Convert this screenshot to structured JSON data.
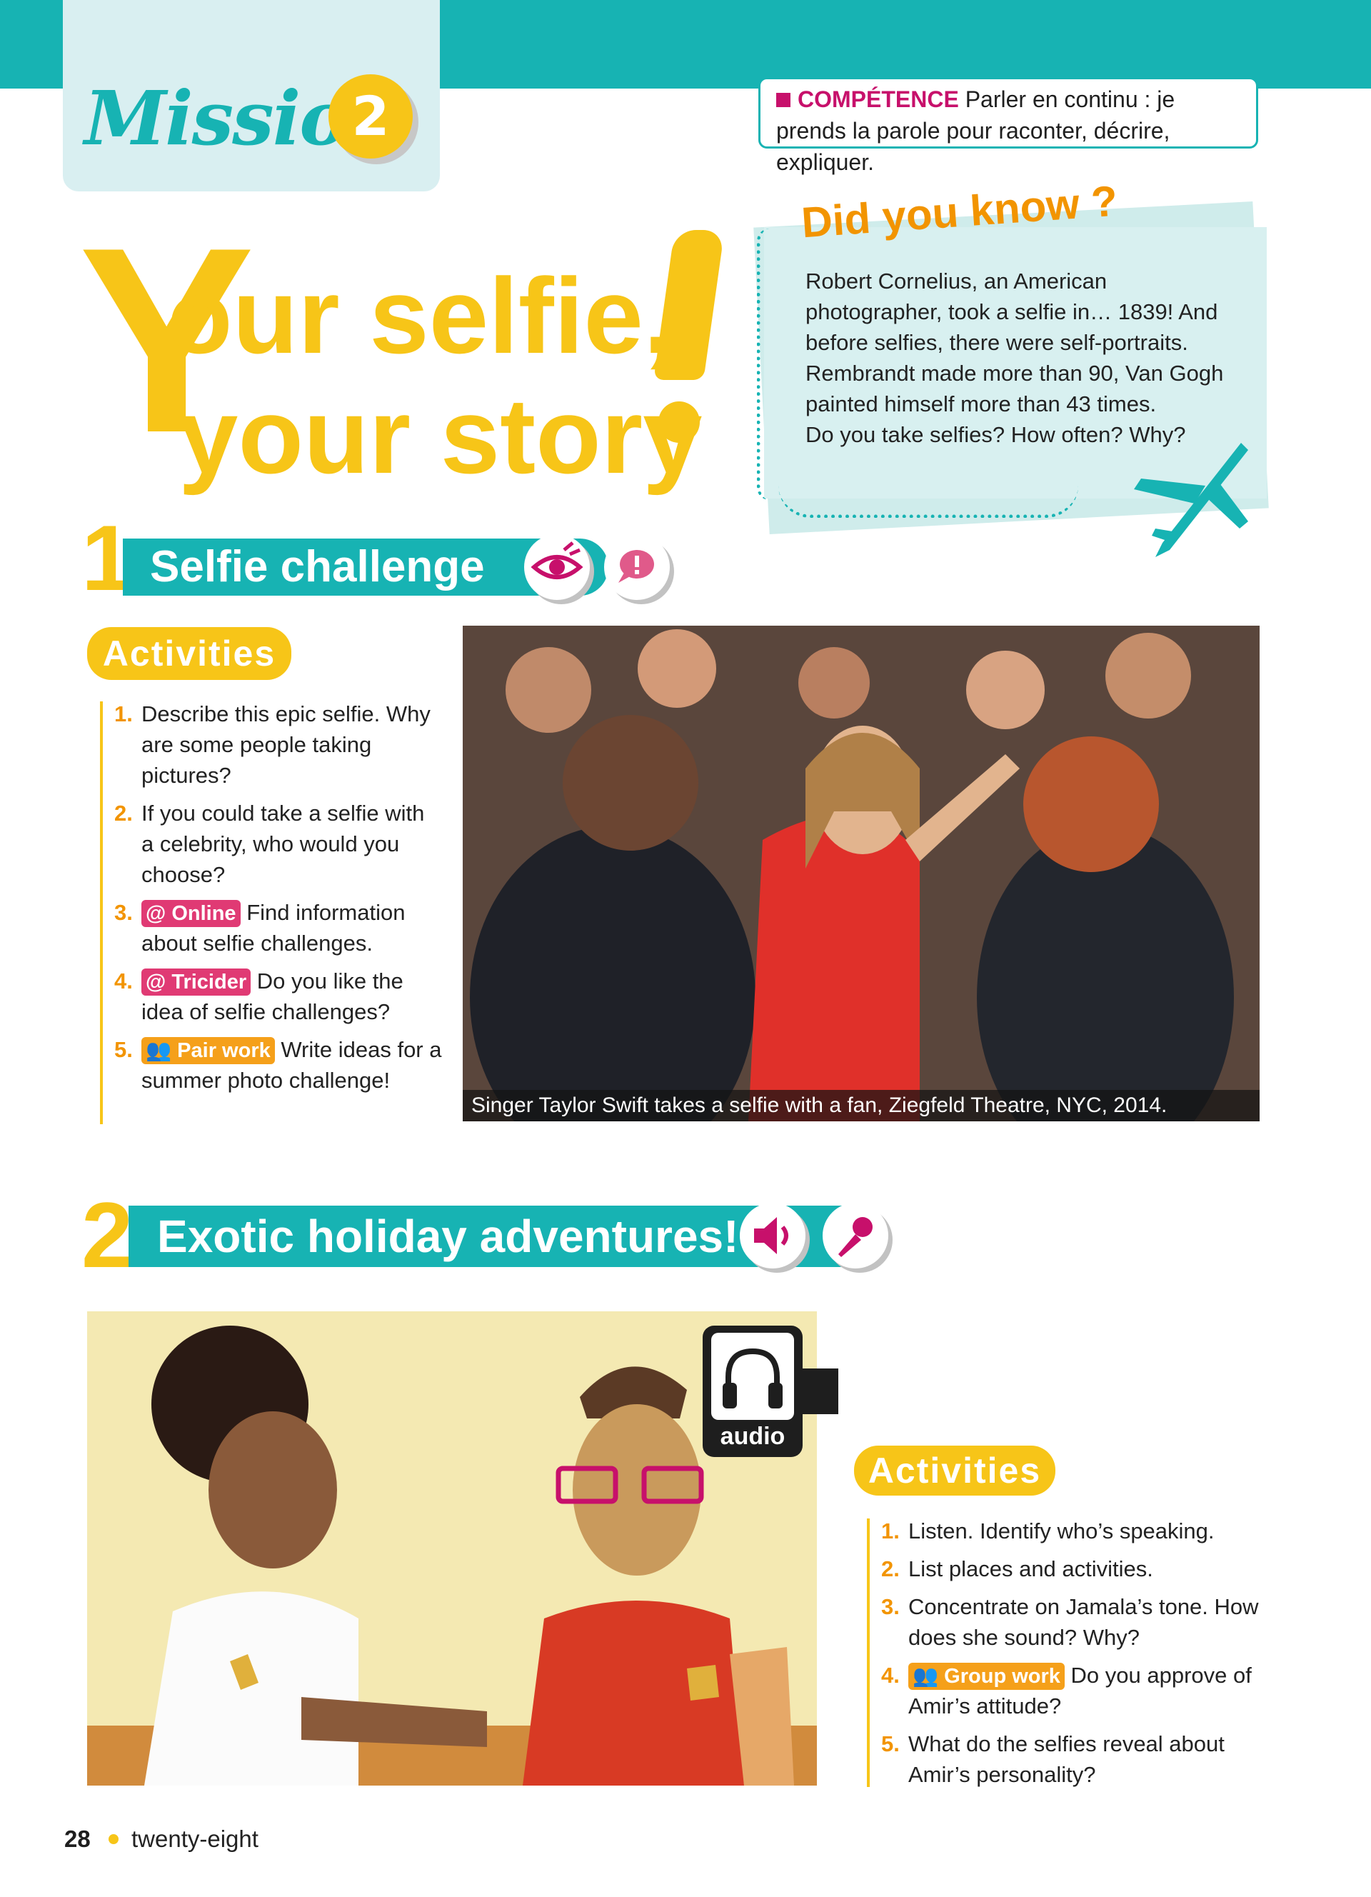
{
  "header": {
    "mission_label": "Mission",
    "mission_number": "2",
    "competence_label": "COMPÉTENCE",
    "competence_text": "Parler en continu : je prends la parole pour raconter, décrire, expliquer."
  },
  "title": {
    "big_letter": "Y",
    "line1": "our selfie,",
    "line2": "your story"
  },
  "did_you_know": {
    "title": "Did you know ?",
    "text": "Robert Cornelius, an American photographer, took a selfie in… 1839! And before selfies, there were self-portraits. Rembrandt made more than 90, Van Gogh painted himself more than 43 times.",
    "question": "Do you take selfies? How often? Why?"
  },
  "section1": {
    "number": "1",
    "title": "Selfie challenge",
    "icons": [
      "eye-icon",
      "speech-bubble-icon"
    ],
    "activities_label": "Activities",
    "items": [
      {
        "num": "1.",
        "tag": "",
        "text": "Describe this epic selfie. Why are some people taking pictures?"
      },
      {
        "num": "2.",
        "tag": "",
        "text": "If you could take a selfie with a celebrity, who would you choose?"
      },
      {
        "num": "3.",
        "tag": "@ Online",
        "text": "Find information about selfie challenges."
      },
      {
        "num": "4.",
        "tag": "@ Tricider",
        "text": "Do you like the idea of selfie challenges?"
      },
      {
        "num": "5.",
        "tag": "Pair work",
        "text": "Write ideas for a summer photo challenge!"
      }
    ],
    "photo_caption": "Singer Taylor Swift takes a selfie with a fan, Ziegfeld Theatre, NYC, 2014."
  },
  "section2": {
    "number": "2",
    "title": "Exotic holiday adventures!",
    "icons": [
      "speaker-icon",
      "microphone-icon"
    ],
    "audio_label": "audio",
    "activities_label": "Activities",
    "items": [
      {
        "num": "1.",
        "tag": "",
        "text": "Listen. Identify who’s speaking."
      },
      {
        "num": "2.",
        "tag": "",
        "text": "List places and activities."
      },
      {
        "num": "3.",
        "tag": "",
        "text": "Concentrate on Jamala’s tone. How does she sound? Why?"
      },
      {
        "num": "4.",
        "tag": "Group work",
        "text": "Do you approve of Amir’s attitude?"
      },
      {
        "num": "5.",
        "tag": "",
        "text": "What do the selfies reveal about Amir’s personality?"
      }
    ]
  },
  "footer": {
    "page_number": "28",
    "page_word": "twenty-eight"
  },
  "colors": {
    "teal": "#17b3b3",
    "yellow": "#f7c518",
    "orange": "#f29400",
    "magenta": "#c7106b",
    "pink_tag": "#e03a74"
  }
}
